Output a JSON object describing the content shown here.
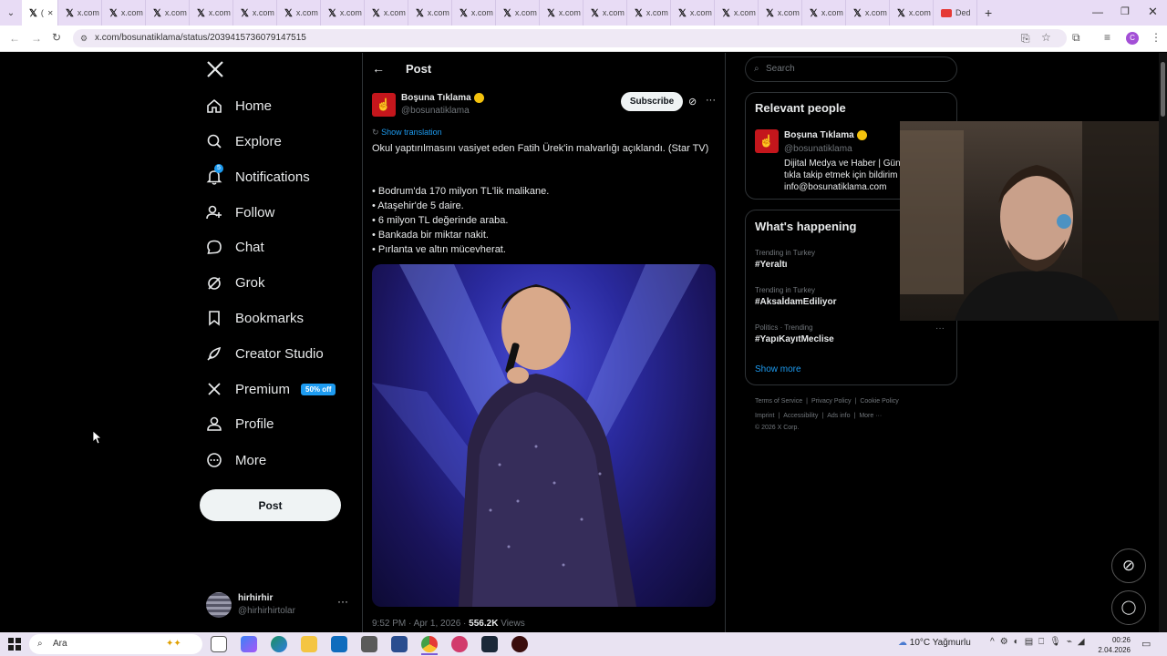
{
  "browser": {
    "tabs": [
      {
        "label": "(",
        "active": true
      },
      {
        "label": "x.com"
      },
      {
        "label": "x.com"
      },
      {
        "label": "x.com"
      },
      {
        "label": "x.com"
      },
      {
        "label": "x.com"
      },
      {
        "label": "x.com"
      },
      {
        "label": "x.com"
      },
      {
        "label": "x.com"
      },
      {
        "label": "x.com"
      },
      {
        "label": "x.com"
      },
      {
        "label": "x.com"
      },
      {
        "label": "x.com"
      },
      {
        "label": "x.com"
      },
      {
        "label": "x.com"
      },
      {
        "label": "x.com"
      },
      {
        "label": "x.com"
      },
      {
        "label": "x.com"
      },
      {
        "label": "x.com"
      },
      {
        "label": "x.com"
      },
      {
        "label": "x.com"
      },
      {
        "label": "Ded",
        "youtube": true
      }
    ],
    "url": "x.com/bosunatiklama/status/2039415736079147515",
    "profile_initial": "C"
  },
  "nav": {
    "items": [
      {
        "label": "Home",
        "icon": "home-icon"
      },
      {
        "label": "Explore",
        "icon": "search-icon"
      },
      {
        "label": "Notifications",
        "icon": "bell-icon",
        "badge": "5"
      },
      {
        "label": "Follow",
        "icon": "person-add-icon"
      },
      {
        "label": "Chat",
        "icon": "chat-icon"
      },
      {
        "label": "Grok",
        "icon": "grok-icon"
      },
      {
        "label": "Bookmarks",
        "icon": "bookmark-icon"
      },
      {
        "label": "Creator Studio",
        "icon": "rocket-icon"
      },
      {
        "label": "Premium",
        "icon": "x-icon",
        "promo": "50% off"
      },
      {
        "label": "Profile",
        "icon": "person-icon"
      },
      {
        "label": "More",
        "icon": "more-circle-icon"
      }
    ],
    "post_label": "Post",
    "account": {
      "name": "hirhirhir",
      "handle": "@hirhirhirtolar"
    }
  },
  "post": {
    "header_title": "Post",
    "author_name": "Boşuna Tıklama",
    "author_handle": "@bosunatiklama",
    "subscribe_label": "Subscribe",
    "show_translation": "Show translation",
    "text_line1": "Okul yaptırılmasını vasiyet eden Fatih Ürek'in malvarlığı açıklandı. (Star TV)",
    "bullets": [
      "• Bodrum'da 170 milyon TL'lik malikane.",
      "• Ataşehir'de 5 daire.",
      "• 6 milyon TL değerinde araba.",
      "• Bankada bir miktar nakit.",
      "• Pırlanta ve altın mücevherat."
    ],
    "timestamp": "9:52 PM · Apr 1, 2026 · ",
    "views_count": "556.2K",
    "views_label": " Views"
  },
  "search": {
    "placeholder": "Search"
  },
  "relevant": {
    "title": "Relevant people",
    "name": "Boşuna Tıklama",
    "handle": "@bosunatiklama",
    "bio": "Dijital Medya ve Haber | Gün tıkla takip etmek için bildirim info@bosunatiklama.com"
  },
  "happening": {
    "title": "What's happening",
    "trends": [
      {
        "meta": "Trending in Turkey",
        "name": "#Yeraltı"
      },
      {
        "meta": "Trending in Turkey",
        "name": "#AksaİdamEdiliyor"
      },
      {
        "meta": "Politics · Trending",
        "name": "#YapıKayıtMeclise"
      }
    ],
    "show_more": "Show more"
  },
  "footer": {
    "links1": [
      "Terms of Service",
      "Privacy Policy",
      "Cookie Policy"
    ],
    "links2": [
      "Imprint",
      "Accessibility",
      "Ads info",
      "More ···"
    ],
    "copyright": "© 2026 X Corp."
  },
  "taskbar": {
    "search_placeholder": "Ara",
    "weather": "10°C  Yağmurlu",
    "time": "00:26",
    "date": "2.04.2026"
  },
  "colors": {
    "accent": "#1d9bf0",
    "promo_bg": "#1d9bf0",
    "verified": "#f4c20d",
    "brand_red": "#c4161c"
  }
}
